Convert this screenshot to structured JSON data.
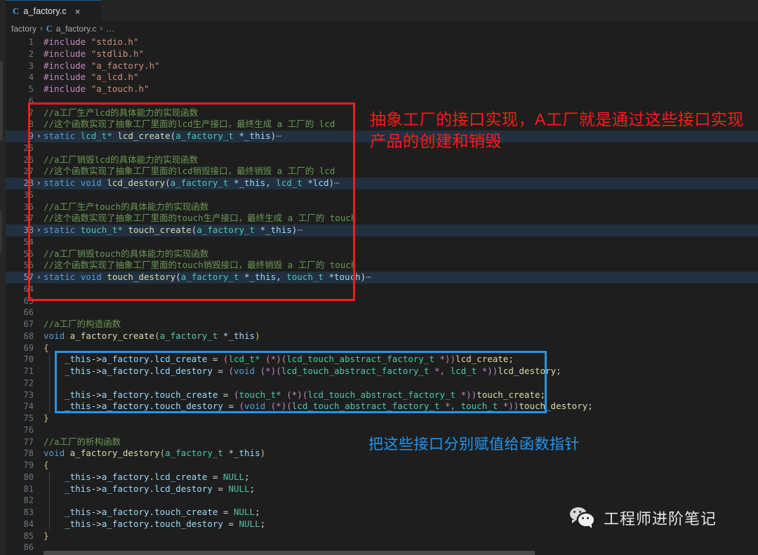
{
  "window": {
    "tab": {
      "label": "a_factory.c",
      "icon": "c-file-icon",
      "close": "×"
    },
    "breadcrumb": {
      "root": "factory",
      "sep": "›",
      "file": "a_factory.c",
      "tail": "…",
      "icon": "c-file-icon"
    }
  },
  "colors": {
    "background": "#1e1e1e",
    "tabbar": "#252526",
    "fold_highlight": "#223040",
    "annotation_red": "#ff1a1a",
    "annotation_blue": "#2196f3",
    "comment": "#6a9955",
    "keyword": "#569cd6",
    "type": "#4ec9b0",
    "function": "#dcdcaa",
    "variable": "#9cdcfe",
    "string": "#ce9178",
    "preprocessor": "#c586c0",
    "linenumber": "#6e7681"
  },
  "editor": {
    "lines": [
      {
        "n": "1",
        "kind": "code",
        "tokens": [
          [
            "pre",
            "#include"
          ],
          [
            "op",
            " "
          ],
          [
            "str",
            "\"stdio.h\""
          ]
        ]
      },
      {
        "n": "2",
        "kind": "code",
        "tokens": [
          [
            "pre",
            "#include"
          ],
          [
            "op",
            " "
          ],
          [
            "str",
            "\"stdlib.h\""
          ]
        ]
      },
      {
        "n": "3",
        "kind": "code",
        "tokens": [
          [
            "pre",
            "#include"
          ],
          [
            "op",
            " "
          ],
          [
            "str",
            "\"a_factory.h\""
          ]
        ]
      },
      {
        "n": "4",
        "kind": "code",
        "tokens": [
          [
            "pre",
            "#include"
          ],
          [
            "op",
            " "
          ],
          [
            "str",
            "\"a_lcd.h\""
          ]
        ]
      },
      {
        "n": "5",
        "kind": "code",
        "tokens": [
          [
            "pre",
            "#include"
          ],
          [
            "op",
            " "
          ],
          [
            "str",
            "\"a_touch.h\""
          ]
        ]
      },
      {
        "n": "6",
        "kind": "blank",
        "tokens": []
      },
      {
        "n": "7",
        "kind": "code",
        "tokens": [
          [
            "cmt",
            "//a工厂生产lcd的具体能力的实现函数"
          ]
        ]
      },
      {
        "n": "8",
        "kind": "code",
        "tokens": [
          [
            "cmt",
            "//这个函数实现了抽象工厂里面的lcd生产接口，最终生成 a 工厂的 lcd"
          ]
        ]
      },
      {
        "n": "9",
        "kind": "fold",
        "tokens": [
          [
            "kw",
            "static"
          ],
          [
            "op",
            " "
          ],
          [
            "typ",
            "lcd_t*"
          ],
          [
            "op",
            " "
          ],
          [
            "fn",
            "lcd_create"
          ],
          [
            "par",
            "("
          ],
          [
            "typ",
            "a_factory_t"
          ],
          [
            "op",
            " "
          ],
          [
            "var",
            "*_this"
          ],
          [
            "par",
            ")"
          ],
          [
            "dots",
            "⋯"
          ]
        ]
      },
      {
        "n": "25",
        "kind": "blank",
        "tokens": []
      },
      {
        "n": "26",
        "kind": "code",
        "tokens": [
          [
            "cmt",
            "//a工厂销毁lcd的具体能力的实现函数"
          ]
        ]
      },
      {
        "n": "27",
        "kind": "code",
        "tokens": [
          [
            "cmt",
            "//这个函数实现了抽象工厂里面的lcd销毁接口，最终销毁 a 工厂的 lcd"
          ]
        ]
      },
      {
        "n": "28",
        "kind": "fold",
        "tokens": [
          [
            "kw",
            "static"
          ],
          [
            "op",
            " "
          ],
          [
            "kw",
            "void"
          ],
          [
            "op",
            " "
          ],
          [
            "fn",
            "lcd_destory"
          ],
          [
            "par",
            "("
          ],
          [
            "typ",
            "a_factory_t"
          ],
          [
            "op",
            " "
          ],
          [
            "var",
            "*_this"
          ],
          [
            "par",
            ", "
          ],
          [
            "typ",
            "lcd_t"
          ],
          [
            "op",
            " "
          ],
          [
            "var",
            "*lcd"
          ],
          [
            "par",
            ")"
          ],
          [
            "dots",
            "⋯"
          ]
        ]
      },
      {
        "n": "35",
        "kind": "blank",
        "tokens": []
      },
      {
        "n": "36",
        "kind": "code",
        "tokens": [
          [
            "cmt",
            "//a工厂生产touch的具体能力的实现函数"
          ]
        ]
      },
      {
        "n": "37",
        "kind": "code",
        "tokens": [
          [
            "cmt",
            "//这个函数实现了抽象工厂里面的touch生产接口，最终生成 a 工厂的 touch"
          ]
        ]
      },
      {
        "n": "38",
        "kind": "fold",
        "tokens": [
          [
            "kw",
            "static"
          ],
          [
            "op",
            " "
          ],
          [
            "typ",
            "touch_t*"
          ],
          [
            "op",
            " "
          ],
          [
            "fn",
            "touch_create"
          ],
          [
            "par",
            "("
          ],
          [
            "typ",
            "a_factory_t"
          ],
          [
            "op",
            " "
          ],
          [
            "var",
            "*_this"
          ],
          [
            "par",
            ")"
          ],
          [
            "dots",
            "⋯"
          ]
        ]
      },
      {
        "n": "54",
        "kind": "blank",
        "tokens": []
      },
      {
        "n": "55",
        "kind": "code",
        "tokens": [
          [
            "cmt",
            "//a工厂销毁touch的具体能力的实现函数"
          ]
        ]
      },
      {
        "n": "56",
        "kind": "code",
        "tokens": [
          [
            "cmt",
            "//这个函数实现了抽象工厂里面的touch销毁接口，最终销毁 a 工厂的 touch"
          ]
        ]
      },
      {
        "n": "57",
        "kind": "fold",
        "tokens": [
          [
            "kw",
            "static"
          ],
          [
            "op",
            " "
          ],
          [
            "kw",
            "void"
          ],
          [
            "op",
            " "
          ],
          [
            "fn",
            "touch_destory"
          ],
          [
            "par",
            "("
          ],
          [
            "typ",
            "a_factory_t"
          ],
          [
            "op",
            " "
          ],
          [
            "var",
            "*_this"
          ],
          [
            "par",
            ", "
          ],
          [
            "typ",
            "touch_t"
          ],
          [
            "op",
            " "
          ],
          [
            "var",
            "*touch"
          ],
          [
            "par",
            ")"
          ],
          [
            "dots",
            "⋯"
          ]
        ]
      },
      {
        "n": "64",
        "kind": "blank",
        "tokens": []
      },
      {
        "n": "65",
        "kind": "blank",
        "tokens": []
      },
      {
        "n": "66",
        "kind": "blank",
        "tokens": []
      },
      {
        "n": "67",
        "kind": "code",
        "tokens": [
          [
            "cmt",
            "//a工厂的构造函数"
          ]
        ]
      },
      {
        "n": "68",
        "kind": "code",
        "tokens": [
          [
            "kw",
            "void"
          ],
          [
            "op",
            " "
          ],
          [
            "fn",
            "a_factory_create"
          ],
          [
            "brc",
            "("
          ],
          [
            "typ",
            "a_factory_t"
          ],
          [
            "op",
            " "
          ],
          [
            "var",
            "*_this"
          ],
          [
            "brc",
            ")"
          ]
        ]
      },
      {
        "n": "69",
        "kind": "code",
        "tokens": [
          [
            "brc",
            "{"
          ]
        ]
      },
      {
        "n": "70",
        "kind": "code",
        "indent": true,
        "tokens": [
          [
            "op",
            "    "
          ],
          [
            "var",
            "_this"
          ],
          [
            "op",
            "->"
          ],
          [
            "var",
            "a_factory"
          ],
          [
            "op",
            "."
          ],
          [
            "var",
            "lcd_create"
          ],
          [
            "op",
            " = "
          ],
          [
            "pk",
            "("
          ],
          [
            "typ",
            "lcd_t*"
          ],
          [
            "op",
            " "
          ],
          [
            "pk",
            "(*)("
          ],
          [
            "typ",
            "lcd_touch_abstract_factory_t"
          ],
          [
            "op",
            " "
          ],
          [
            "pk",
            "*))"
          ],
          [
            "fn",
            "lcd_create"
          ],
          [
            "op",
            ";"
          ]
        ]
      },
      {
        "n": "71",
        "kind": "code",
        "indent": true,
        "tokens": [
          [
            "op",
            "    "
          ],
          [
            "var",
            "_this"
          ],
          [
            "op",
            "->"
          ],
          [
            "var",
            "a_factory"
          ],
          [
            "op",
            "."
          ],
          [
            "var",
            "lcd_destory"
          ],
          [
            "op",
            " = "
          ],
          [
            "pk",
            "("
          ],
          [
            "kw",
            "void"
          ],
          [
            "op",
            " "
          ],
          [
            "pk",
            "(*)("
          ],
          [
            "typ",
            "lcd_touch_abstract_factory_t"
          ],
          [
            "op",
            " "
          ],
          [
            "pk",
            "*, "
          ],
          [
            "typ",
            "lcd_t"
          ],
          [
            "op",
            " "
          ],
          [
            "pk",
            "*))"
          ],
          [
            "fn",
            "lcd_destory"
          ],
          [
            "op",
            ";"
          ]
        ]
      },
      {
        "n": "72",
        "kind": "blank",
        "indent": true,
        "tokens": []
      },
      {
        "n": "73",
        "kind": "code",
        "indent": true,
        "tokens": [
          [
            "op",
            "    "
          ],
          [
            "var",
            "_this"
          ],
          [
            "op",
            "->"
          ],
          [
            "var",
            "a_factory"
          ],
          [
            "op",
            "."
          ],
          [
            "var",
            "touch_create"
          ],
          [
            "op",
            " = "
          ],
          [
            "pk",
            "("
          ],
          [
            "typ",
            "touch_t*"
          ],
          [
            "op",
            " "
          ],
          [
            "pk",
            "(*)("
          ],
          [
            "typ",
            "lcd_touch_abstract_factory_t"
          ],
          [
            "op",
            " "
          ],
          [
            "pk",
            "*))"
          ],
          [
            "fn",
            "touch_create"
          ],
          [
            "op",
            ";"
          ]
        ]
      },
      {
        "n": "74",
        "kind": "code",
        "indent": true,
        "tokens": [
          [
            "op",
            "    "
          ],
          [
            "var",
            "_this"
          ],
          [
            "op",
            "->"
          ],
          [
            "var",
            "a_factory"
          ],
          [
            "op",
            "."
          ],
          [
            "var",
            "touch_destory"
          ],
          [
            "op",
            " = "
          ],
          [
            "pk",
            "("
          ],
          [
            "kw",
            "void"
          ],
          [
            "op",
            " "
          ],
          [
            "pk",
            "(*)("
          ],
          [
            "typ",
            "lcd_touch_abstract_factory_t"
          ],
          [
            "op",
            " "
          ],
          [
            "pk",
            "*, "
          ],
          [
            "typ",
            "touch_t"
          ],
          [
            "op",
            " "
          ],
          [
            "pk",
            "*))"
          ],
          [
            "fn",
            "touch_destory"
          ],
          [
            "op",
            ";"
          ]
        ]
      },
      {
        "n": "75",
        "kind": "code",
        "tokens": [
          [
            "brc",
            "}"
          ]
        ]
      },
      {
        "n": "76",
        "kind": "blank",
        "tokens": []
      },
      {
        "n": "77",
        "kind": "code",
        "tokens": [
          [
            "cmt",
            "//a工厂的析构函数"
          ]
        ]
      },
      {
        "n": "78",
        "kind": "code",
        "tokens": [
          [
            "kw",
            "void"
          ],
          [
            "op",
            " "
          ],
          [
            "fn",
            "a_factory_destory"
          ],
          [
            "brc",
            "("
          ],
          [
            "typ",
            "a_factory_t"
          ],
          [
            "op",
            " "
          ],
          [
            "var",
            "*_this"
          ],
          [
            "brc",
            ")"
          ]
        ]
      },
      {
        "n": "79",
        "kind": "code",
        "tokens": [
          [
            "brc",
            "{"
          ]
        ]
      },
      {
        "n": "80",
        "kind": "code",
        "indent": true,
        "tokens": [
          [
            "op",
            "    "
          ],
          [
            "var",
            "_this"
          ],
          [
            "op",
            "->"
          ],
          [
            "var",
            "a_factory"
          ],
          [
            "op",
            "."
          ],
          [
            "var",
            "lcd_create"
          ],
          [
            "op",
            " = "
          ],
          [
            "cn",
            "NULL"
          ],
          [
            "op",
            ";"
          ]
        ]
      },
      {
        "n": "81",
        "kind": "code",
        "indent": true,
        "tokens": [
          [
            "op",
            "    "
          ],
          [
            "var",
            "_this"
          ],
          [
            "op",
            "->"
          ],
          [
            "var",
            "a_factory"
          ],
          [
            "op",
            "."
          ],
          [
            "var",
            "lcd_destory"
          ],
          [
            "op",
            " = "
          ],
          [
            "cn",
            "NULL"
          ],
          [
            "op",
            ";"
          ]
        ]
      },
      {
        "n": "82",
        "kind": "blank",
        "indent": true,
        "tokens": []
      },
      {
        "n": "83",
        "kind": "code",
        "indent": true,
        "tokens": [
          [
            "op",
            "    "
          ],
          [
            "var",
            "_this"
          ],
          [
            "op",
            "->"
          ],
          [
            "var",
            "a_factory"
          ],
          [
            "op",
            "."
          ],
          [
            "var",
            "touch_create"
          ],
          [
            "op",
            " = "
          ],
          [
            "cn",
            "NULL"
          ],
          [
            "op",
            ";"
          ]
        ]
      },
      {
        "n": "84",
        "kind": "code",
        "indent": true,
        "tokens": [
          [
            "op",
            "    "
          ],
          [
            "var",
            "_this"
          ],
          [
            "op",
            "->"
          ],
          [
            "var",
            "a_factory"
          ],
          [
            "op",
            "."
          ],
          [
            "var",
            "touch_destory"
          ],
          [
            "op",
            " = "
          ],
          [
            "cn",
            "NULL"
          ],
          [
            "op",
            ";"
          ]
        ]
      },
      {
        "n": "85",
        "kind": "code",
        "tokens": [
          [
            "brc",
            "}"
          ]
        ]
      },
      {
        "n": "86",
        "kind": "blank",
        "tokens": []
      }
    ],
    "fold_arrow": "›"
  },
  "annotations": {
    "red": "抽象工厂的接口实现，A工厂就是通过这些接口实现产品的创建和销毁",
    "blue": "把这些接口分别赋值给函数指针"
  },
  "watermark": {
    "label": "工程师进阶笔记",
    "icon": "wechat-icon"
  }
}
